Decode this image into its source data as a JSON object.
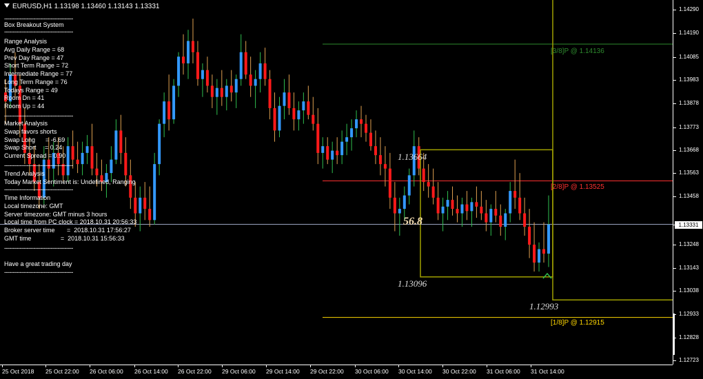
{
  "window": {
    "title": "EURUSD,H1  1.13198 1.13460 1.13143 1.13331"
  },
  "panel": {
    "system_title": "Box Breakout System",
    "range_heading": "Range Analysis",
    "range_lines": [
      "Avg Daily Range = 68",
      "Prev Day Range = 47",
      "Short Term Range = 72",
      "Intermediate Range = 77",
      "Long Term Range = 76",
      "Todays Range = 49",
      "Room Dn = 41",
      "Room Up = 44"
    ],
    "market_heading": "Market Analysis",
    "market_lines": [
      "Swap favors shorts",
      "Swap Long      = -6.69",
      "Swap Short     = 0.24",
      "Current Spread = 0.90"
    ],
    "trend_heading": "Trend Analysis",
    "trend_lines": [
      "Today Market Sentiment is: Undefined, Ranging"
    ],
    "time_heading": "Time Information",
    "time_lines": [
      "Local timezone: GMT",
      "Server timezone: GMT minus 3 hours",
      "Local time from PC clock = 2018.10.31 20:56:33",
      "Broker server time       =  2018.10.31 17:56:27",
      "GMT time                 =  2018.10.31 15:56:33"
    ],
    "greeting": "Have a great trading day",
    "separator": "----------------------------------------"
  },
  "chart_labels": {
    "box_top_price": "1.13664",
    "box_bottom_price": "1.13096",
    "box_range": "56.8",
    "lower_price": "1.12993",
    "level_3_8": "[3/8]P @ 1.14136",
    "level_2_8": "[2/8]P @ 1.13525",
    "level_1_8": "[1/8]P @ 1.12915"
  },
  "price_axis": {
    "labels": [
      "1.14290",
      "1.14190",
      "1.14085",
      "1.13983",
      "1.13878",
      "1.13773",
      "1.13668",
      "1.13563",
      "1.13458",
      "1.13331",
      "1.13248",
      "1.13143",
      "1.13038",
      "1.12933",
      "1.12828",
      "1.12723"
    ],
    "current_price": "1.13331"
  },
  "time_axis": {
    "labels": [
      "25 Oct 2018",
      "25 Oct 22:00",
      "26 Oct 06:00",
      "26 Oct 14:00",
      "26 Oct 22:00",
      "29 Oct 06:00",
      "29 Oct 14:00",
      "29 Oct 22:00",
      "30 Oct 06:00",
      "30 Oct 14:00",
      "30 Oct 22:00",
      "31 Oct 06:00",
      "31 Oct 14:00"
    ]
  },
  "colors": {
    "bull": "#3399ff",
    "bear": "#ff1a1a",
    "box": "#a0a000",
    "level_3_8": "#2e8b2e",
    "level_2_8": "#ff3030",
    "level_1_8": "#ffd700",
    "current_price_line": "#9aa3c0"
  },
  "chart_data": {
    "type": "candlestick",
    "symbol": "EURUSD",
    "timeframe": "H1",
    "ylim": [
      1.127,
      1.1433
    ],
    "ohlc_last": {
      "open": 1.13198,
      "high": 1.1346,
      "low": 1.13143,
      "close": 1.13331
    },
    "levels": [
      {
        "name": "[3/8]P",
        "value": 1.14136
      },
      {
        "name": "[2/8]P",
        "value": 1.13525
      },
      {
        "name": "[1/8]P",
        "value": 1.12915
      }
    ],
    "box": {
      "top": 1.13664,
      "bottom": 1.13096,
      "range_pips": 56.8
    },
    "candles": [
      [
        1.1392,
        1.1398,
        1.1378,
        1.1388
      ],
      [
        1.1388,
        1.1405,
        1.1385,
        1.14
      ],
      [
        1.14,
        1.141,
        1.139,
        1.1395
      ],
      [
        1.1395,
        1.14,
        1.1372,
        1.1378
      ],
      [
        1.1378,
        1.1385,
        1.136,
        1.1365
      ],
      [
        1.1365,
        1.1372,
        1.1355,
        1.136
      ],
      [
        1.136,
        1.1368,
        1.1348,
        1.1352
      ],
      [
        1.1352,
        1.136,
        1.134,
        1.1345
      ],
      [
        1.1345,
        1.1368,
        1.1342,
        1.1362
      ],
      [
        1.1362,
        1.1372,
        1.1352,
        1.1358
      ],
      [
        1.1358,
        1.137,
        1.135,
        1.1365
      ],
      [
        1.1365,
        1.1372,
        1.1355,
        1.136
      ],
      [
        1.136,
        1.1368,
        1.1352,
        1.1355
      ],
      [
        1.1355,
        1.1372,
        1.1352,
        1.1368
      ],
      [
        1.1368,
        1.1375,
        1.1358,
        1.1362
      ],
      [
        1.1362,
        1.137,
        1.1356,
        1.136
      ],
      [
        1.136,
        1.137,
        1.1355,
        1.1365
      ],
      [
        1.1365,
        1.1373,
        1.136,
        1.1368
      ],
      [
        1.1368,
        1.1378,
        1.1355,
        1.1358
      ],
      [
        1.1358,
        1.1365,
        1.135,
        1.1355
      ],
      [
        1.1355,
        1.1362,
        1.1348,
        1.1352
      ],
      [
        1.1352,
        1.136,
        1.1345,
        1.1356
      ],
      [
        1.1356,
        1.1368,
        1.1352,
        1.1362
      ],
      [
        1.1362,
        1.138,
        1.136,
        1.1375
      ],
      [
        1.1375,
        1.1382,
        1.136,
        1.1365
      ],
      [
        1.1365,
        1.1372,
        1.135,
        1.1355
      ],
      [
        1.1355,
        1.1362,
        1.134,
        1.1345
      ],
      [
        1.1345,
        1.1352,
        1.1332,
        1.1338
      ],
      [
        1.1338,
        1.135,
        1.133,
        1.1345
      ],
      [
        1.1345,
        1.1352,
        1.1335,
        1.134
      ],
      [
        1.134,
        1.135,
        1.1332,
        1.1335
      ],
      [
        1.1335,
        1.1365,
        1.1333,
        1.136
      ],
      [
        1.136,
        1.138,
        1.1355,
        1.1378
      ],
      [
        1.1378,
        1.1392,
        1.1372,
        1.1388
      ],
      [
        1.1388,
        1.14,
        1.1375,
        1.138
      ],
      [
        1.138,
        1.1398,
        1.1378,
        1.1395
      ],
      [
        1.1395,
        1.141,
        1.139,
        1.1408
      ],
      [
        1.1408,
        1.1418,
        1.14,
        1.1405
      ],
      [
        1.1405,
        1.142,
        1.1398,
        1.1415
      ],
      [
        1.1415,
        1.1425,
        1.1405,
        1.141
      ],
      [
        1.141,
        1.1415,
        1.1395,
        1.1398
      ],
      [
        1.1398,
        1.1405,
        1.139,
        1.1402
      ],
      [
        1.1402,
        1.1408,
        1.1392,
        1.1395
      ],
      [
        1.1395,
        1.14,
        1.1385,
        1.139
      ],
      [
        1.139,
        1.1398,
        1.1382,
        1.1394
      ],
      [
        1.1394,
        1.1402,
        1.1386,
        1.139
      ],
      [
        1.139,
        1.1398,
        1.1384,
        1.1395
      ],
      [
        1.1395,
        1.1402,
        1.1388,
        1.1392
      ],
      [
        1.1392,
        1.14,
        1.1385,
        1.1398
      ],
      [
        1.1398,
        1.1418,
        1.1395,
        1.141
      ],
      [
        1.141,
        1.1415,
        1.1398,
        1.14
      ],
      [
        1.14,
        1.1408,
        1.139,
        1.1395
      ],
      [
        1.1395,
        1.1402,
        1.1385,
        1.1398
      ],
      [
        1.1398,
        1.141,
        1.1392,
        1.1405
      ],
      [
        1.1405,
        1.1412,
        1.1395,
        1.1398
      ],
      [
        1.1398,
        1.1402,
        1.138,
        1.1385
      ],
      [
        1.1385,
        1.1392,
        1.137,
        1.1375
      ],
      [
        1.1375,
        1.139,
        1.1372,
        1.1386
      ],
      [
        1.1386,
        1.1398,
        1.138,
        1.1392
      ],
      [
        1.1392,
        1.14,
        1.1382,
        1.1385
      ],
      [
        1.1385,
        1.1392,
        1.1375,
        1.138
      ],
      [
        1.138,
        1.1388,
        1.1375,
        1.1384
      ],
      [
        1.1384,
        1.1392,
        1.1378,
        1.1388
      ],
      [
        1.1388,
        1.1395,
        1.138,
        1.1382
      ],
      [
        1.1382,
        1.139,
        1.1375,
        1.1378
      ],
      [
        1.1378,
        1.1385,
        1.136,
        1.1365
      ],
      [
        1.1365,
        1.1372,
        1.1358,
        1.1368
      ],
      [
        1.1368,
        1.1372,
        1.136,
        1.1362
      ],
      [
        1.1362,
        1.137,
        1.1356,
        1.1366
      ],
      [
        1.1366,
        1.1372,
        1.136,
        1.1364
      ],
      [
        1.1364,
        1.1375,
        1.136,
        1.137
      ],
      [
        1.137,
        1.1378,
        1.1364,
        1.1372
      ],
      [
        1.1372,
        1.138,
        1.1366,
        1.1376
      ],
      [
        1.1376,
        1.1384,
        1.1372,
        1.138
      ],
      [
        1.138,
        1.1386,
        1.1372,
        1.1378
      ],
      [
        1.1378,
        1.1382,
        1.137,
        1.1374
      ],
      [
        1.1374,
        1.138,
        1.1366,
        1.1368
      ],
      [
        1.1368,
        1.1375,
        1.136,
        1.1364
      ],
      [
        1.1364,
        1.1372,
        1.1355,
        1.136
      ],
      [
        1.136,
        1.1368,
        1.135,
        1.1358
      ],
      [
        1.1358,
        1.1365,
        1.134,
        1.1345
      ],
      [
        1.1345,
        1.1352,
        1.133,
        1.1338
      ],
      [
        1.1338,
        1.1345,
        1.1328,
        1.134
      ],
      [
        1.134,
        1.135,
        1.1335,
        1.1346
      ],
      [
        1.1346,
        1.1358,
        1.1342,
        1.1355
      ],
      [
        1.1355,
        1.1375,
        1.135,
        1.1368
      ],
      [
        1.1368,
        1.1372,
        1.1355,
        1.1358
      ],
      [
        1.1358,
        1.1365,
        1.1348,
        1.1352
      ],
      [
        1.1352,
        1.136,
        1.1345,
        1.135
      ],
      [
        1.135,
        1.1358,
        1.1342,
        1.1345
      ],
      [
        1.1345,
        1.1352,
        1.1335,
        1.1338
      ],
      [
        1.1338,
        1.1345,
        1.133,
        1.1341
      ],
      [
        1.1341,
        1.1348,
        1.1335,
        1.1344
      ],
      [
        1.1344,
        1.135,
        1.1337,
        1.134
      ],
      [
        1.134,
        1.1346,
        1.1334,
        1.1338
      ],
      [
        1.1338,
        1.1345,
        1.1332,
        1.1342
      ],
      [
        1.1342,
        1.1348,
        1.1335,
        1.1339
      ],
      [
        1.1339,
        1.1345,
        1.1332,
        1.1343
      ],
      [
        1.1343,
        1.135,
        1.1336,
        1.1341
      ],
      [
        1.1341,
        1.1348,
        1.1335,
        1.1338
      ],
      [
        1.1338,
        1.1344,
        1.133,
        1.1334
      ],
      [
        1.1334,
        1.1342,
        1.1328,
        1.134
      ],
      [
        1.134,
        1.1348,
        1.1334,
        1.1337
      ],
      [
        1.1337,
        1.1342,
        1.1328,
        1.1332
      ],
      [
        1.1332,
        1.134,
        1.1326,
        1.1338
      ],
      [
        1.1338,
        1.1352,
        1.1334,
        1.1348
      ],
      [
        1.1348,
        1.1362,
        1.134,
        1.1345
      ],
      [
        1.1345,
        1.1356,
        1.1335,
        1.1338
      ],
      [
        1.1338,
        1.1345,
        1.1328,
        1.1332
      ],
      [
        1.1332,
        1.134,
        1.1318,
        1.1324
      ],
      [
        1.1324,
        1.1334,
        1.1312,
        1.1316
      ],
      [
        1.1316,
        1.1325,
        1.1312,
        1.1322
      ],
      [
        1.1322,
        1.1334,
        1.1316,
        1.132
      ],
      [
        1.132,
        1.1346,
        1.1314,
        1.1333
      ]
    ]
  }
}
